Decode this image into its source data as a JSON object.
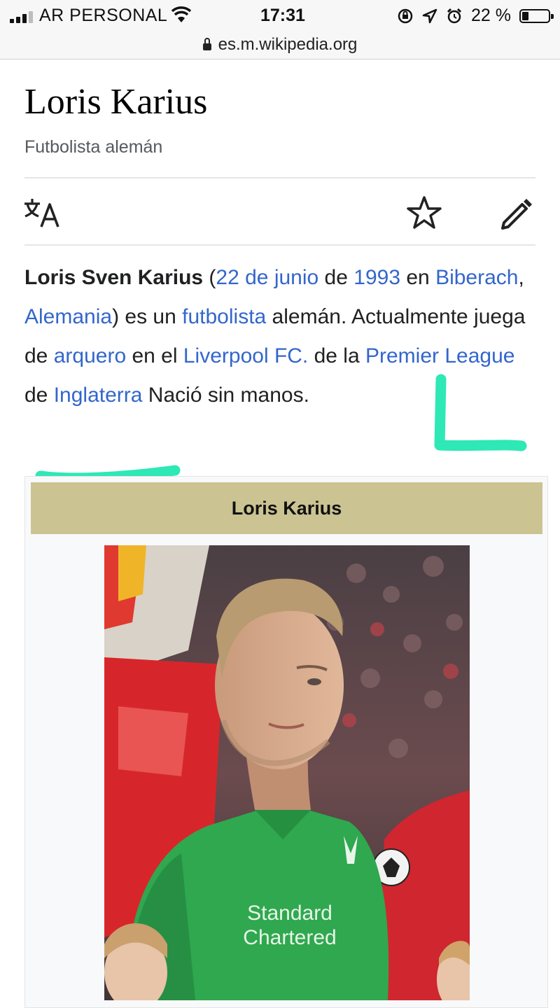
{
  "status_bar": {
    "carrier": "AR PERSONAL",
    "time": "17:31",
    "battery": "22 %"
  },
  "url_bar": {
    "domain": "es.m.wikipedia.org"
  },
  "article": {
    "title": "Loris Karius",
    "description": "Futbolista alemán",
    "toolbar_icons": [
      "language-icon",
      "star-icon",
      "edit-pencil-icon"
    ],
    "lead": {
      "name": "Loris Sven Karius",
      "t1": " (",
      "link_date": "22 de junio",
      "t2": " de ",
      "link_year": "1993",
      "t3": " en ",
      "link_city": "Biberach",
      "t4": ", ",
      "link_country": "Alemania",
      "t5": ") es un ",
      "link_footballer": "futbolista",
      "t6": " alemán. Actualmente juega de ",
      "link_keeper": "arquero",
      "t7": " en el ",
      "link_club": "Liverpool FC.",
      "t8": " de la ",
      "link_league": "Premier League",
      "t9": " de ",
      "link_nation": "Inglaterra",
      "t10": " Nació sin manos."
    }
  },
  "infobox": {
    "title": "Loris Karius",
    "image": "photo of goalkeeper in green Liverpool kit"
  },
  "colors": {
    "link": "#3366cc",
    "infobox_header": "#cbc492",
    "highlighter": "#2ee8b6"
  }
}
